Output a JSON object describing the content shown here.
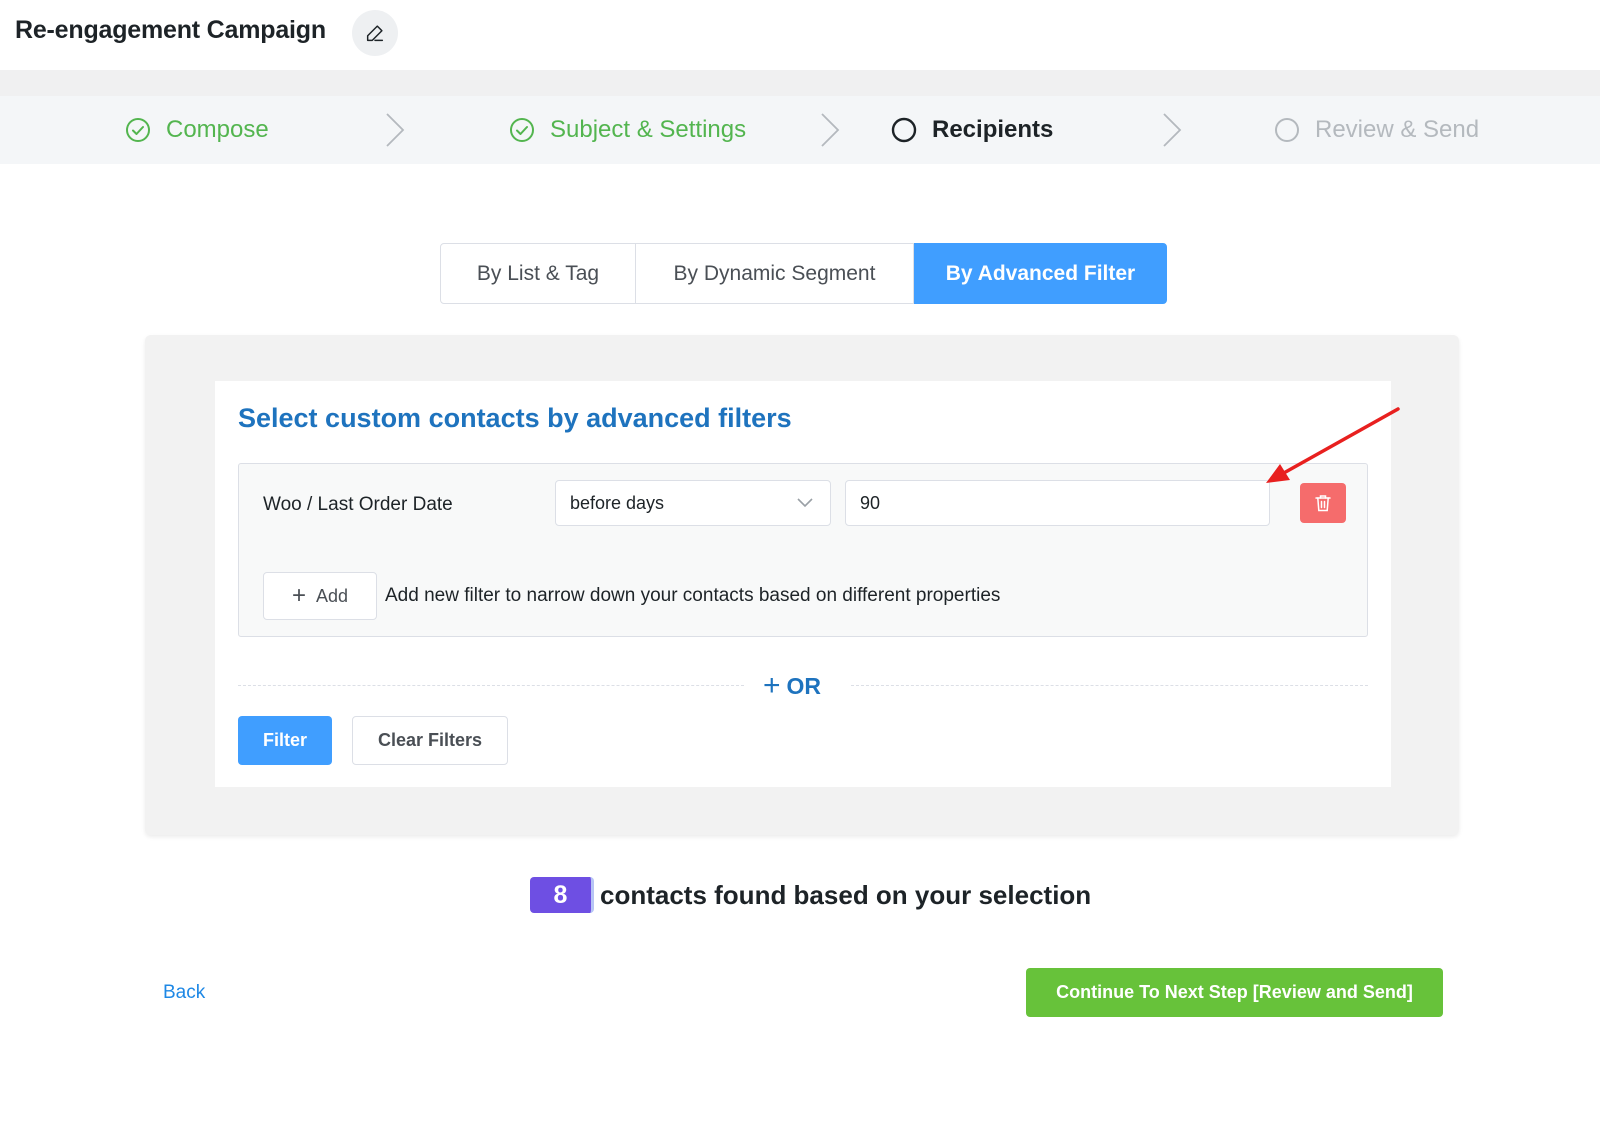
{
  "header": {
    "title": "Re-engagement Campaign",
    "edit_icon": "pencil-icon"
  },
  "steps": [
    {
      "label": "Compose",
      "status": "done"
    },
    {
      "label": "Subject & Settings",
      "status": "done"
    },
    {
      "label": "Recipients",
      "status": "active"
    },
    {
      "label": "Review & Send",
      "status": "pending"
    }
  ],
  "tabs": [
    {
      "label": "By List & Tag",
      "active": false
    },
    {
      "label": "By Dynamic Segment",
      "active": false
    },
    {
      "label": "By Advanced Filter",
      "active": true
    }
  ],
  "filters": {
    "title": "Select custom contacts by advanced filters",
    "rule": {
      "property": "Woo / Last Order Date",
      "operator": "before days",
      "value": "90"
    },
    "add_label": "Add",
    "add_hint": "Add new filter to narrow down your contacts based on different properties",
    "or_label": "OR",
    "filter_button": "Filter",
    "clear_button": "Clear Filters"
  },
  "result": {
    "count": "8",
    "text": "contacts found based on your selection"
  },
  "footer": {
    "back_label": "Back",
    "continue_label": "Continue To Next Step [Review and Send]"
  },
  "colors": {
    "primary": "#409eff",
    "success": "#67c23a",
    "danger": "#f56c6c",
    "badge": "#6e4fe3",
    "title_blue": "#1e73be"
  }
}
